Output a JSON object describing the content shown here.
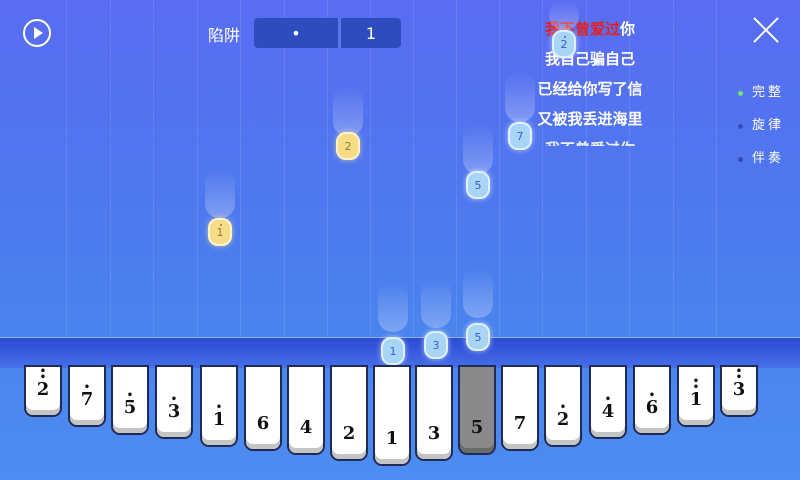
{
  "header": {
    "song_title": "陷阱",
    "segment_left": "•",
    "segment_right": "1"
  },
  "lyrics": {
    "line1_sung": "我不曾爱过",
    "line1_rest": "你",
    "line2": "我自己骗自己",
    "line3": "已经给你写了信",
    "line4": "又被我丢进海里",
    "line5": "我不曾爱过你"
  },
  "modes": [
    {
      "label": "完整",
      "active": true
    },
    {
      "label": "旋律",
      "active": false
    },
    {
      "label": "伴奏",
      "active": false
    }
  ],
  "falling_notes": [
    {
      "digit": "2",
      "style": "blue"
    },
    {
      "digit": "2",
      "style": "gold"
    },
    {
      "digit": "7",
      "style": "blue"
    },
    {
      "digit": "5",
      "style": "blue"
    },
    {
      "digit": "1",
      "style": "gold"
    },
    {
      "digit": "1",
      "style": "blue"
    },
    {
      "digit": "3",
      "style": "blue"
    },
    {
      "digit": "5",
      "style": "blue"
    }
  ],
  "keys": [
    {
      "digit": "2",
      "dots_above": 2,
      "dots_below": 0,
      "pressed": false
    },
    {
      "digit": "7",
      "dots_above": 1,
      "dots_below": 0,
      "pressed": false
    },
    {
      "digit": "5",
      "dots_above": 1,
      "dots_below": 0,
      "pressed": false
    },
    {
      "digit": "3",
      "dots_above": 1,
      "dots_below": 0,
      "pressed": false
    },
    {
      "digit": "1",
      "dots_above": 1,
      "dots_below": 0,
      "pressed": false
    },
    {
      "digit": "6",
      "dots_above": 0,
      "dots_below": 0,
      "pressed": false
    },
    {
      "digit": "4",
      "dots_above": 0,
      "dots_below": 0,
      "pressed": false
    },
    {
      "digit": "2",
      "dots_above": 0,
      "dots_below": 0,
      "pressed": false
    },
    {
      "digit": "1",
      "dots_above": 0,
      "dots_below": 0,
      "pressed": false
    },
    {
      "digit": "3",
      "dots_above": 0,
      "dots_below": 0,
      "pressed": false
    },
    {
      "digit": "5",
      "dots_above": 0,
      "dots_below": 0,
      "pressed": true
    },
    {
      "digit": "7",
      "dots_above": 0,
      "dots_below": 0,
      "pressed": false
    },
    {
      "digit": "2",
      "dots_above": 1,
      "dots_below": 0,
      "pressed": false
    },
    {
      "digit": "4",
      "dots_above": 1,
      "dots_below": 0,
      "pressed": false
    },
    {
      "digit": "6",
      "dots_above": 1,
      "dots_below": 0,
      "pressed": false
    },
    {
      "digit": "1",
      "dots_above": 2,
      "dots_below": 0,
      "pressed": false
    },
    {
      "digit": "3",
      "dots_above": 2,
      "dots_below": 0,
      "pressed": false
    }
  ],
  "colors": {
    "background_top": "#5a6cf2",
    "background_bottom": "#4d8cf0",
    "sung_lyric": "#e52020",
    "active_mode_dot": "#6fe06f"
  }
}
